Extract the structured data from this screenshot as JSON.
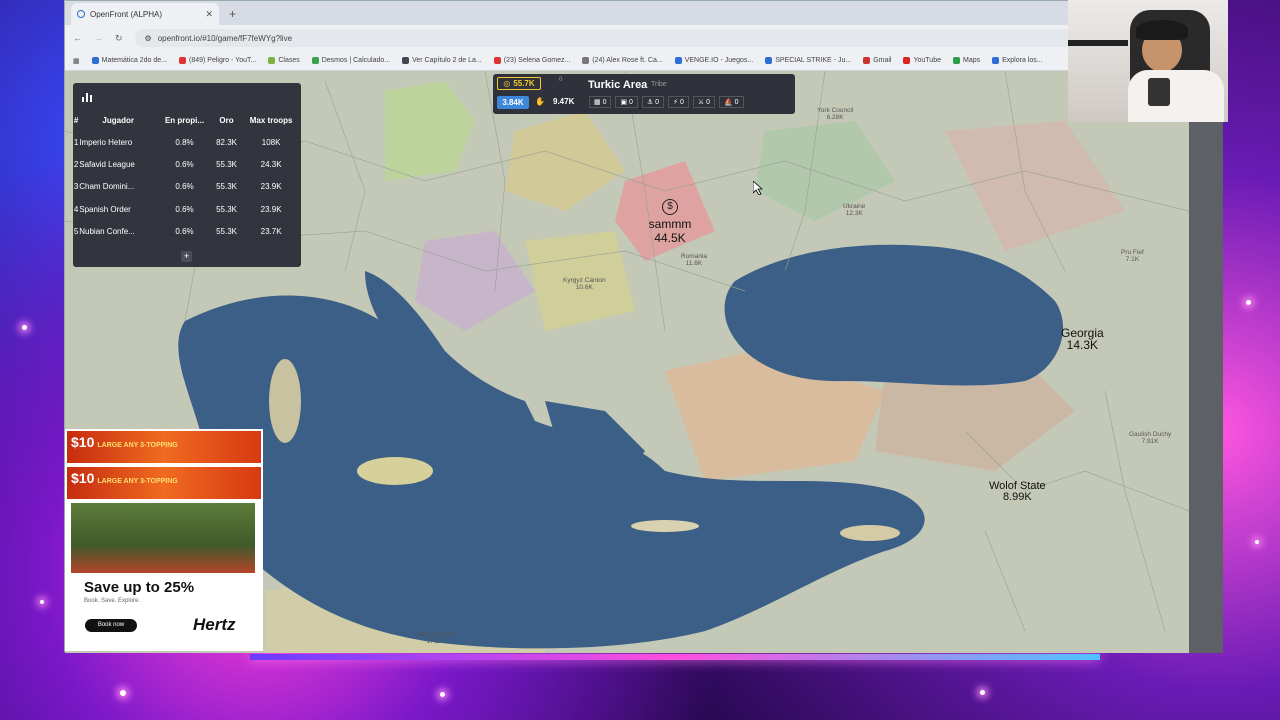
{
  "browser": {
    "tab_title": "OpenFront (ALPHA)",
    "url": "openfront.io/#10/game/fF7feWYg?live",
    "bookmarks": [
      "Matemática 2do de...",
      "(849) Peligro - YouT...",
      "Clases",
      "Desmos | Calculado...",
      "Ver Capítulo 2 de La...",
      "(23) Selena Gomez...",
      "(24) Alex Rose ft. Ca...",
      "VENGE.IO - Juegos...",
      "SPECIAL STRIKE - Ju...",
      "Gmail",
      "YouTube",
      "Maps",
      "Explora los..."
    ]
  },
  "leaderboard": {
    "headers": [
      "#",
      "Jugador",
      "En propi...",
      "Oro",
      "Max troops"
    ],
    "rows": [
      {
        "rank": "1",
        "player": "Imperio Hetero",
        "owned": "0.8%",
        "gold": "82.3K",
        "troops": "108K"
      },
      {
        "rank": "2",
        "player": "Safavid League",
        "owned": "0.6%",
        "gold": "55.3K",
        "troops": "24.3K"
      },
      {
        "rank": "3",
        "player": "Cham Domini...",
        "owned": "0.6%",
        "gold": "55.3K",
        "troops": "23.9K"
      },
      {
        "rank": "4",
        "player": "Spanish Order",
        "owned": "0.6%",
        "gold": "55.3K",
        "troops": "23.9K"
      },
      {
        "rank": "5",
        "player": "Nubian Confe...",
        "owned": "0.6%",
        "gold": "55.3K",
        "troops": "23.7K"
      }
    ],
    "expand_label": "+"
  },
  "info_panel": {
    "gold": "55.7K",
    "small_top": "",
    "small_bottom": "0",
    "name": "Turkic Area",
    "type": "Tribe",
    "troops": "3.84K",
    "workers": "9.47K",
    "counts": [
      "0",
      "0",
      "0",
      "0",
      "0",
      "0"
    ]
  },
  "map": {
    "player": {
      "name": "sammm",
      "troops": "44.5K"
    },
    "labels_big": [
      {
        "name": "Georgia",
        "value": "14.3K"
      },
      {
        "name": "Wolof State",
        "value": "8.99K"
      }
    ],
    "labels_small": [
      "York Council\n6.28K",
      "Ukraine\n12.3K",
      "Romania\n11.6K",
      "Kyrgyz Canton\n10.6K",
      "State of Libya\n17.1K",
      "Pru Fief\n7.1K",
      "Gaulish Duchy\n7.91K"
    ]
  },
  "ad": {
    "promo_price": "$10",
    "promo_text": "LARGE ANY 3-TOPPING",
    "headline": "Save up to 25%",
    "subline": "Book. Save. Explore.",
    "cta": "Book now",
    "brand": "Hertz"
  },
  "colors": {
    "gold": "#f4c92c",
    "troops": "#3d86d8",
    "player": "#e35a5a",
    "sea": "#3b5f86"
  }
}
